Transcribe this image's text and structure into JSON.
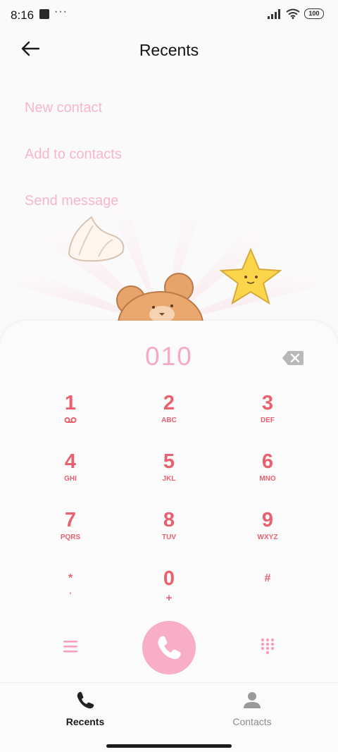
{
  "status_bar": {
    "time": "8:16",
    "battery": "100",
    "icons": [
      "notification-square-icon",
      "more-dots-icon",
      "signal-icon",
      "wifi-icon",
      "battery-icon"
    ]
  },
  "header": {
    "title": "Recents",
    "back_icon": "back-arrow-icon"
  },
  "options": [
    {
      "label": "New contact"
    },
    {
      "label": "Add to contacts"
    },
    {
      "label": "Send message"
    }
  ],
  "dialer": {
    "number": "010",
    "backspace_icon": "backspace-icon",
    "keys": [
      {
        "digit": "1",
        "letters": "",
        "sub_icon": "voicemail-icon"
      },
      {
        "digit": "2",
        "letters": "ABC"
      },
      {
        "digit": "3",
        "letters": "DEF"
      },
      {
        "digit": "4",
        "letters": "GHI"
      },
      {
        "digit": "5",
        "letters": "JKL"
      },
      {
        "digit": "6",
        "letters": "MNO"
      },
      {
        "digit": "7",
        "letters": "PQRS"
      },
      {
        "digit": "8",
        "letters": "TUV"
      },
      {
        "digit": "9",
        "letters": "WXYZ"
      },
      {
        "digit": "*",
        "letters": ","
      },
      {
        "digit": "0",
        "letters": "+"
      },
      {
        "digit": "#",
        "letters": ""
      }
    ],
    "menu_icon": "menu-lines-icon",
    "call_icon": "phone-icon",
    "keypad_icon": "keypad-dots-icon"
  },
  "bottom_nav": {
    "items": [
      {
        "label": "Recents",
        "icon": "phone-icon",
        "active": true
      },
      {
        "label": "Contacts",
        "icon": "person-icon",
        "active": false
      }
    ]
  },
  "colors": {
    "accent_pink": "#f9aec8",
    "digit_red": "#e9616e",
    "option_pink": "#f7b6cf"
  }
}
